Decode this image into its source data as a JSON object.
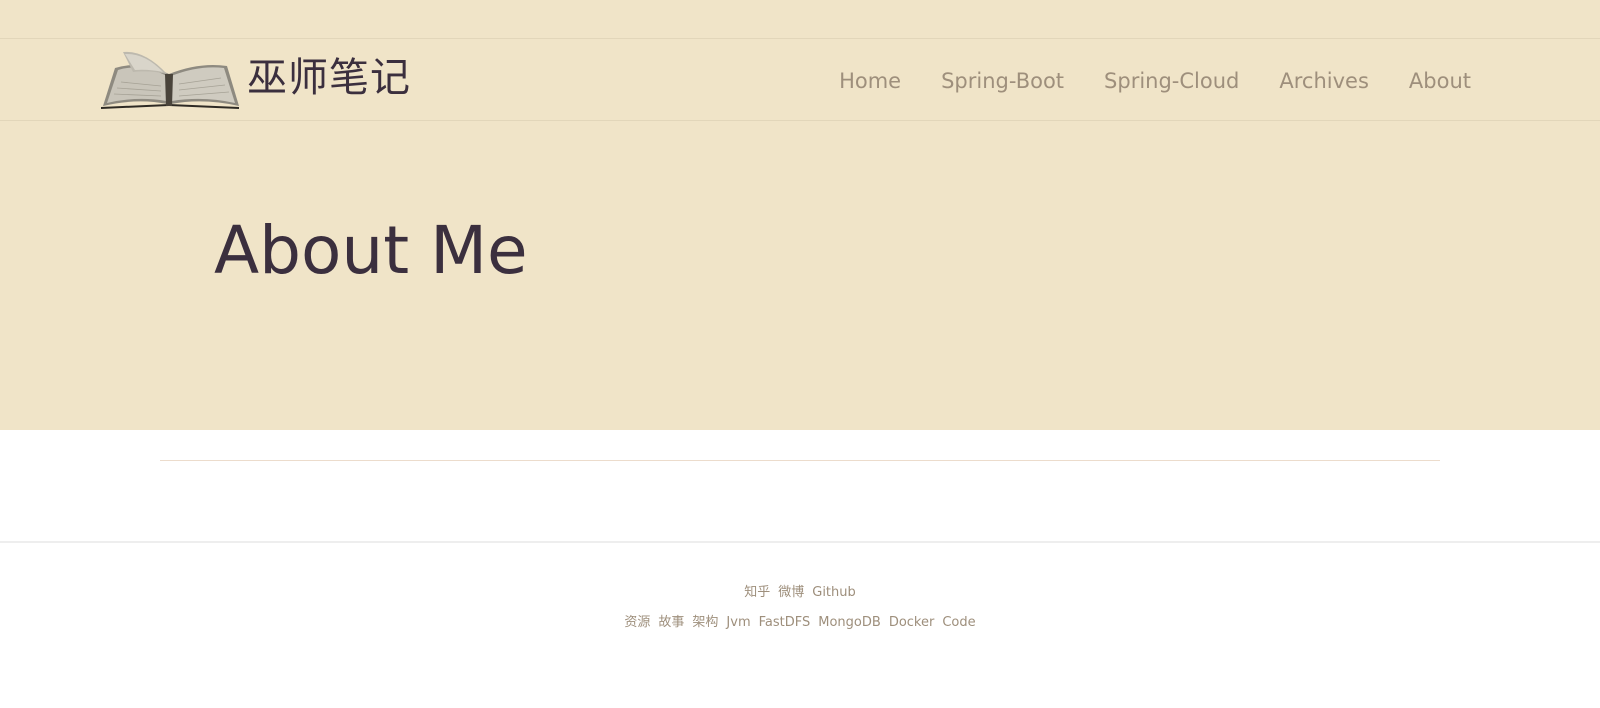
{
  "header": {
    "brand_title": "巫师笔记",
    "logo_icon": "open-book-icon",
    "nav": [
      {
        "label": "Home"
      },
      {
        "label": "Spring-Boot"
      },
      {
        "label": "Spring-Cloud"
      },
      {
        "label": "Archives"
      },
      {
        "label": "About"
      }
    ]
  },
  "hero": {
    "title": "About Me"
  },
  "footer": {
    "row1": [
      {
        "label": "知乎"
      },
      {
        "label": "微博"
      },
      {
        "label": "Github"
      }
    ],
    "row2": [
      {
        "label": "资源"
      },
      {
        "label": "故事"
      },
      {
        "label": "架构"
      },
      {
        "label": "Jvm"
      },
      {
        "label": "FastDFS"
      },
      {
        "label": "MongoDB"
      },
      {
        "label": "Docker"
      },
      {
        "label": "Code"
      }
    ]
  },
  "colors": {
    "header_bg": "#f0e4c8",
    "title_text": "#3b2f3e",
    "link_text": "#9e8f7c"
  }
}
